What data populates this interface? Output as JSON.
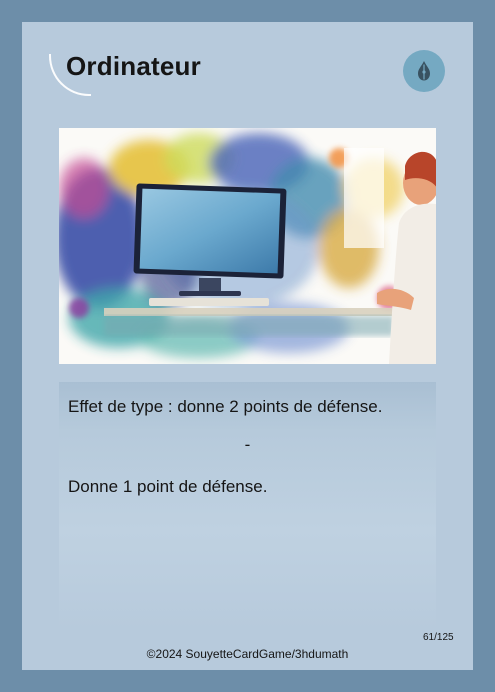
{
  "card": {
    "title": "Ordinateur",
    "effect_line": "Effet de type : donne 2 points de défense.",
    "separator": "-",
    "bonus_line": "Donne 1 point de défense.",
    "card_number": "61/125",
    "copyright": "©2024 SouyetteCardGame/3hdumath",
    "type_icon": "ink-drop-icon",
    "artwork": "watercolor-computer-illustration",
    "colors": {
      "frame": "#6d8ea9",
      "card": "#b7cadc",
      "badge": "#75a9c2",
      "text": "#151515"
    }
  }
}
